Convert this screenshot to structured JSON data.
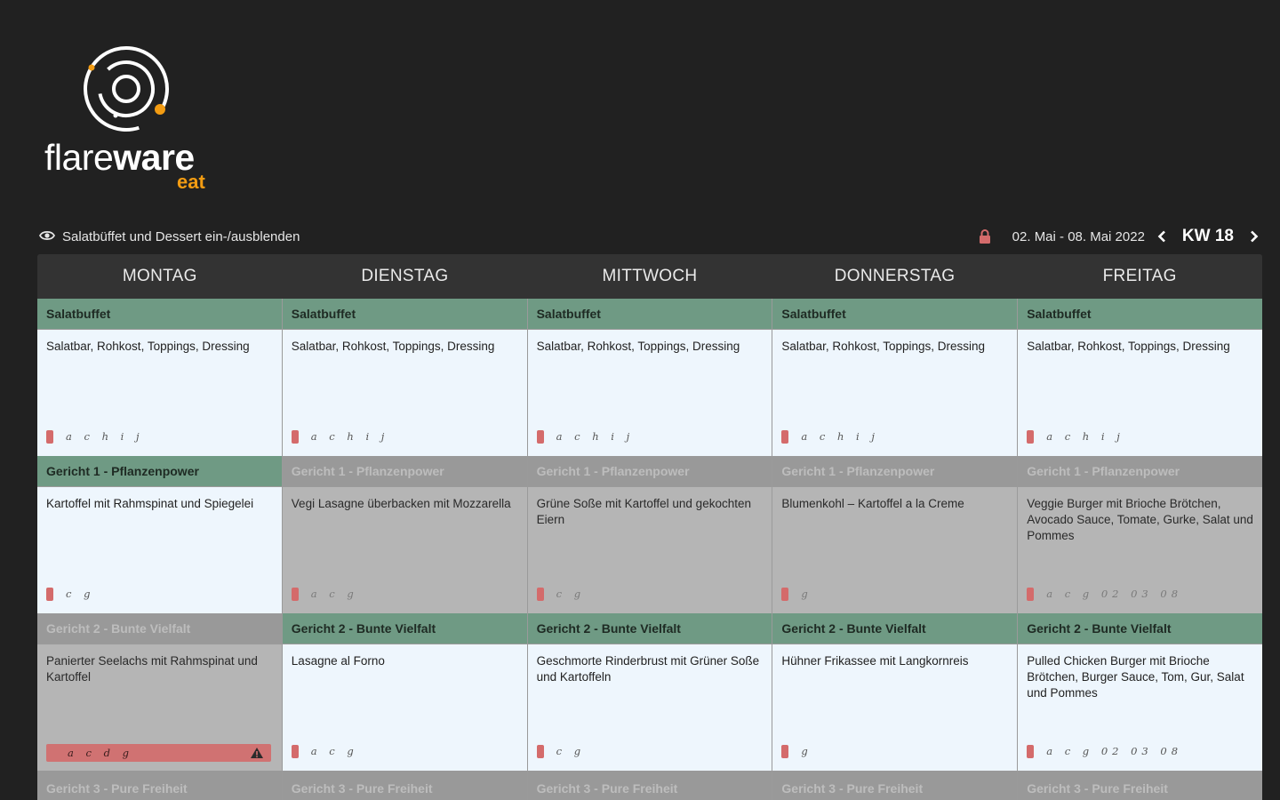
{
  "brand": {
    "wordmark_thin": "flare",
    "wordmark_bold": "ware",
    "sub": "eat"
  },
  "toolbar": {
    "toggle_label": "Salatbüffet und Dessert ein-/ausblenden",
    "date_range": "02. Mai - 08. Mai 2022",
    "week_label": "KW 18"
  },
  "days": [
    "MONTAG",
    "DIENSTAG",
    "MITTWOCH",
    "DONNERSTAG",
    "FREITAG"
  ],
  "rows": [
    {
      "cells": [
        {
          "title": "Salatbuffet",
          "active": true,
          "desc": "Salatbar, Rohkost, Toppings, Dressing",
          "codes": "a c h i j"
        },
        {
          "title": "Salatbuffet",
          "active": true,
          "desc": "Salatbar, Rohkost, Toppings, Dressing",
          "codes": "a c h i j"
        },
        {
          "title": "Salatbuffet",
          "active": true,
          "desc": "Salatbar, Rohkost, Toppings, Dressing",
          "codes": "a c h i j"
        },
        {
          "title": "Salatbuffet",
          "active": true,
          "desc": "Salatbar, Rohkost, Toppings, Dressing",
          "codes": "a c h i j"
        },
        {
          "title": "Salatbuffet",
          "active": true,
          "desc": "Salatbar, Rohkost, Toppings, Dressing",
          "codes": "a c h i j"
        }
      ]
    },
    {
      "cells": [
        {
          "title": "Gericht 1 - Pflanzenpower",
          "active": true,
          "desc": "Kartoffel mit Rahmspinat und Spiegelei",
          "codes": "c g"
        },
        {
          "title": "Gericht 1 - Pflanzenpower",
          "active": false,
          "desc": "Vegi Lasagne überbacken mit Mozzarella",
          "codes": "a c g"
        },
        {
          "title": "Gericht 1 - Pflanzenpower",
          "active": false,
          "desc": "Grüne Soße mit Kartoffel und gekochten Eiern",
          "codes": "c g"
        },
        {
          "title": "Gericht 1 - Pflanzenpower",
          "active": false,
          "desc": "Blumenkohl – Kartoffel a la Creme",
          "codes": "g"
        },
        {
          "title": "Gericht 1 - Pflanzenpower",
          "active": false,
          "desc": "Veggie Burger mit Brioche Brötchen, Avocado Sauce, Tomate, Gurke, Salat und Pommes",
          "codes": "a c g 02 03 08"
        }
      ]
    },
    {
      "cells": [
        {
          "title": "Gericht 2 - Bunte Vielfalt",
          "active": false,
          "desc": "Panierter Seelachs mit Rahmspinat und Kartoffel",
          "codes": "a c d g",
          "warning": true
        },
        {
          "title": "Gericht 2 - Bunte Vielfalt",
          "active": true,
          "desc": "Lasagne al Forno",
          "codes": "a c g"
        },
        {
          "title": "Gericht 2 - Bunte Vielfalt",
          "active": true,
          "desc": "Geschmorte Rinderbrust mit Grüner Soße und Kartoffeln",
          "codes": "c g"
        },
        {
          "title": "Gericht 2 - Bunte Vielfalt",
          "active": true,
          "desc": "Hühner Frikassee mit Langkornreis",
          "codes": "g"
        },
        {
          "title": "Gericht 2 - Bunte Vielfalt",
          "active": true,
          "desc": "Pulled Chicken Burger mit Brioche Brötchen, Burger Sauce, Tom, Gur, Salat und Pommes",
          "codes": "a c g 02 03 08"
        }
      ]
    },
    {
      "cells": [
        {
          "title": "Gericht 3 - Pure Freiheit",
          "active": false
        },
        {
          "title": "Gericht 3 - Pure Freiheit",
          "active": false
        },
        {
          "title": "Gericht 3 - Pure Freiheit",
          "active": false
        },
        {
          "title": "Gericht 3 - Pure Freiheit",
          "active": false
        },
        {
          "title": "Gericht 3 - Pure Freiheit",
          "active": false
        }
      ]
    }
  ],
  "colors": {
    "accent": "#f39c12",
    "active_header": "#6f9a84",
    "inactive": "#b5b5b5",
    "allergen_marker": "#d46b6b"
  },
  "icons": [
    "eye-icon",
    "lock-icon",
    "chevron-left-icon",
    "chevron-right-icon",
    "warning-icon"
  ]
}
